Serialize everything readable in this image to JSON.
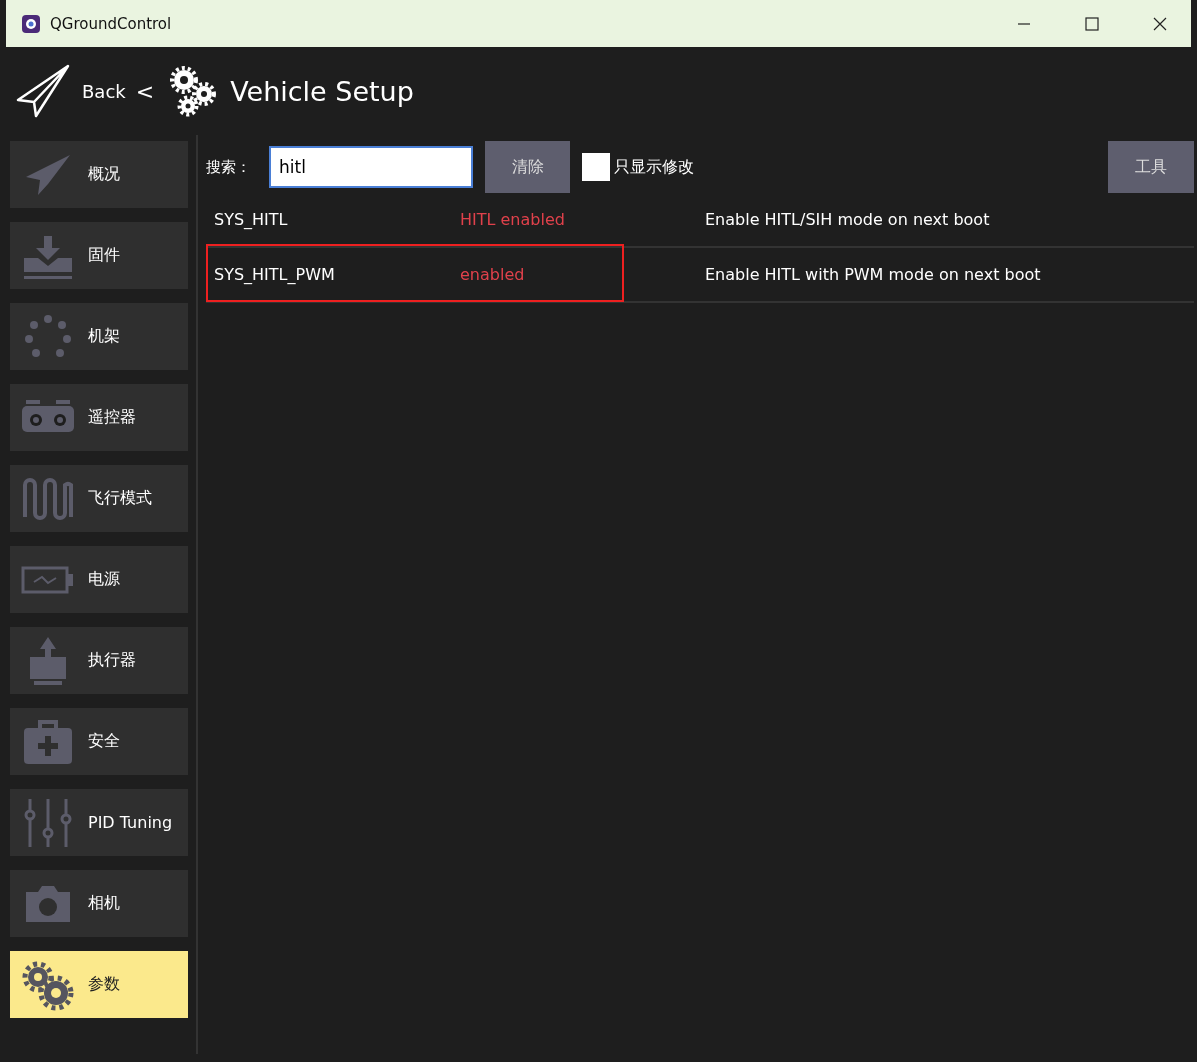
{
  "window": {
    "title": "QGroundControl"
  },
  "header": {
    "back": "Back",
    "separator": "<",
    "title": "Vehicle Setup"
  },
  "sidebar": {
    "items": [
      {
        "label": "概况",
        "selected": false
      },
      {
        "label": "固件",
        "selected": false
      },
      {
        "label": "机架",
        "selected": false
      },
      {
        "label": "遥控器",
        "selected": false
      },
      {
        "label": "飞行模式",
        "selected": false
      },
      {
        "label": "电源",
        "selected": false
      },
      {
        "label": "执行器",
        "selected": false
      },
      {
        "label": "安全",
        "selected": false
      },
      {
        "label": "PID Tuning",
        "selected": false
      },
      {
        "label": "相机",
        "selected": false
      },
      {
        "label": "参数",
        "selected": true
      }
    ]
  },
  "toolbar": {
    "search_label": "搜索：",
    "search_value": "hitl",
    "clear_button": "清除",
    "show_modified": {
      "label": "只显示修改",
      "checked": false
    },
    "tools_button": "工具"
  },
  "parameters": [
    {
      "name": "SYS_HITL",
      "value": "HITL enabled",
      "description": "Enable HITL/SIH mode on next boot",
      "modified": true,
      "highlighted": false
    },
    {
      "name": "SYS_HITL_PWM",
      "value": "enabled",
      "description": "Enable HITL with PWM mode on next boot",
      "modified": true,
      "highlighted": true
    }
  ]
}
